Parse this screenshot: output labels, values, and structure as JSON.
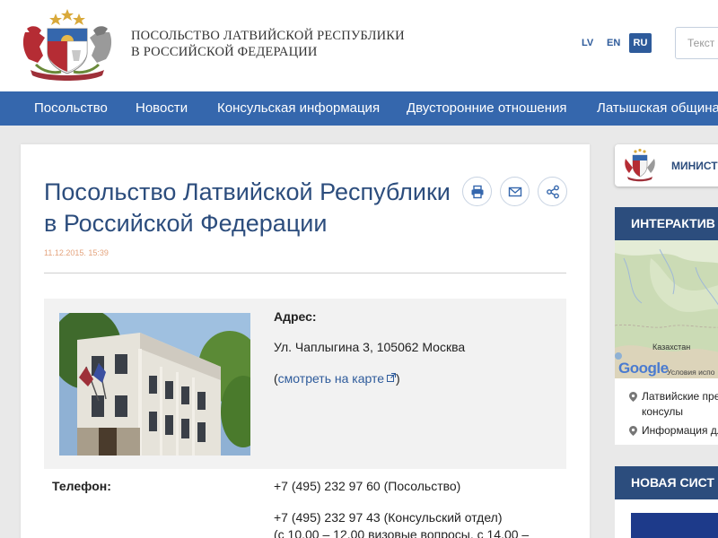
{
  "header": {
    "site_title_line1": "ПОСОЛЬСТВО ЛАТВИЙСКОЙ РЕСПУБЛИКИ",
    "site_title_line2": "В РОССИЙСКОЙ ФЕДЕРАЦИИ",
    "languages": [
      {
        "label": "LV",
        "active": false
      },
      {
        "label": "EN",
        "active": false
      },
      {
        "label": "RU",
        "active": true
      }
    ],
    "search_placeholder": "Текст"
  },
  "nav": {
    "items": [
      "Посольство",
      "Новости",
      "Консульская информация",
      "Двусторонние отношения",
      "Латышская община"
    ]
  },
  "article": {
    "title_line1": "Посольство Латвийской Республики",
    "title_line2": "в Российской Федерации",
    "date": "11.12.2015. 15:39",
    "actions": [
      {
        "icon": "print-icon"
      },
      {
        "icon": "mail-icon"
      },
      {
        "icon": "share-icon"
      }
    ],
    "address_label": "Адрес:",
    "address_value": "Ул. Чаплыгина 3, 105062 Москва",
    "map_link_open": "(",
    "map_link_text": "смотреть на карте",
    "map_link_close": ")",
    "phone_label": "Телефон:",
    "phone_1": "+7 (495) 232 97 60 (Посольство)",
    "phone_2": "+7 (495) 232 97 43 (Консульский отдел)",
    "phone_3": "(с 10.00 – 12.00 визовые вопросы, с 14.00 –"
  },
  "sidebar": {
    "ministry_label": "МИНИСТЕ",
    "interactive_heading": "ИНТЕРАКТИВ",
    "map_country_label": "Казахстан",
    "map_google": "Google",
    "map_terms": "Условия испо",
    "map_items": [
      {
        "line1": "Латвийские пре",
        "line2": "консулы"
      },
      {
        "line1": "Информация дл",
        "line2": ""
      }
    ],
    "new_system_heading": "НОВАЯ СИСТ"
  },
  "colors": {
    "nav_blue": "#3567ad",
    "title_blue": "#2c4d7d",
    "date_orange": "#e4a47e",
    "latvian_red": "#9e3039"
  }
}
